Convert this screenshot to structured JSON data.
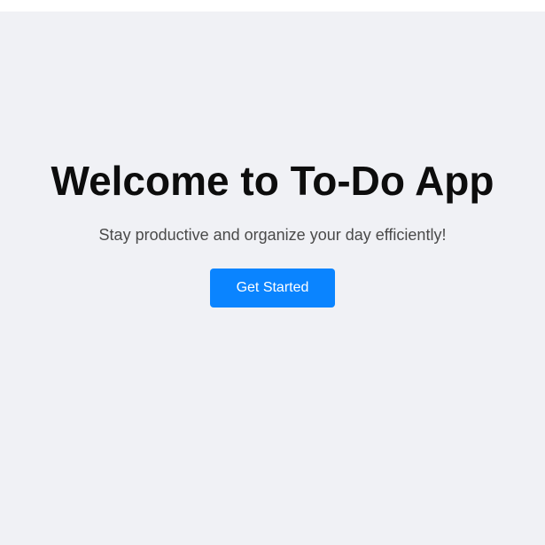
{
  "hero": {
    "title": "Welcome to To-Do App",
    "subtitle": "Stay productive and organize your day efficiently!",
    "cta_label": "Get Started"
  },
  "colors": {
    "background": "#f0f1f5",
    "accent": "#0a84ff",
    "title": "#0d0d0d",
    "subtitle": "#4a4a4a"
  }
}
